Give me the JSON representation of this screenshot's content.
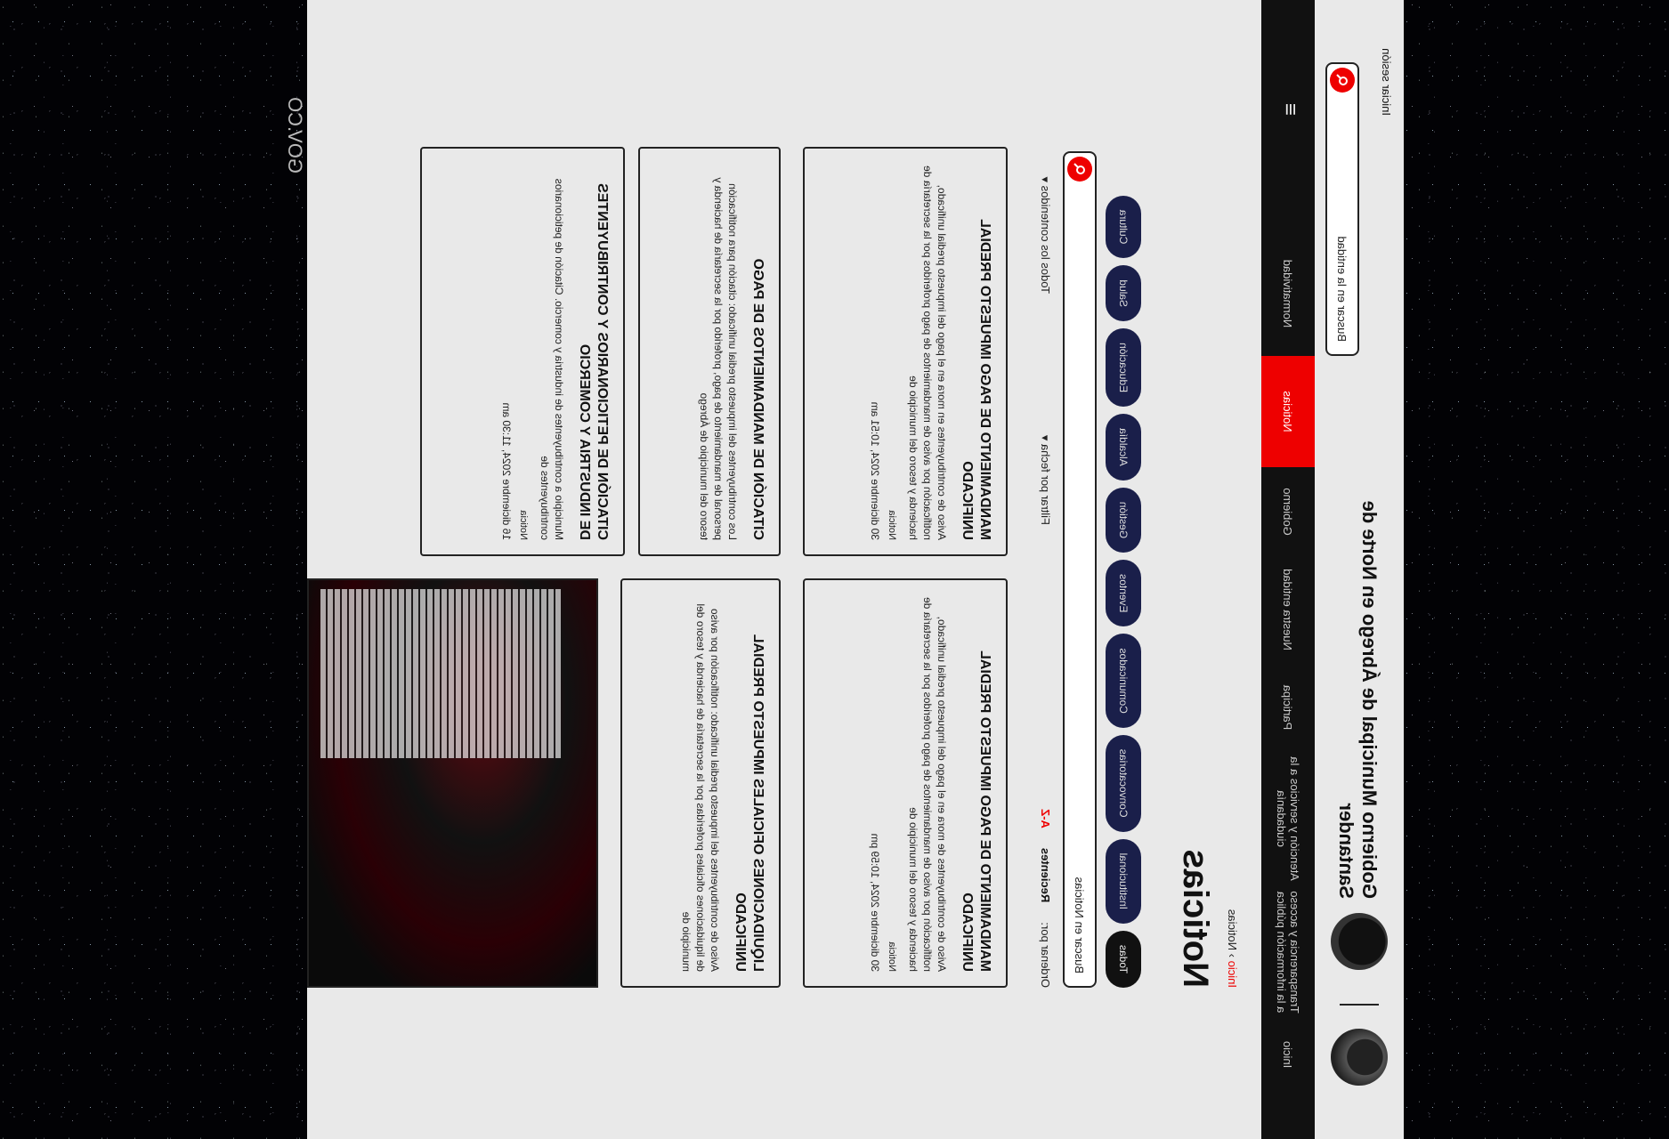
{
  "gov": {
    "logo": "GOV.CO"
  },
  "header": {
    "entity": "Gobierno Municipal de Ábrego en Norte de Santander",
    "search_placeholder": "Buscar en la entidad",
    "login": "Iniciar sesión"
  },
  "nav": {
    "items": [
      "Inicio",
      "Transparencia y acceso a la información pública",
      "Atención y servicios a la ciudadanía",
      "Participa",
      "Nuestra entidad",
      "Gobierno",
      "Noticias",
      "Normatividad"
    ],
    "active": "Noticias"
  },
  "breadcrumb": {
    "home": "Inicio",
    "current": "Noticias"
  },
  "page": {
    "title": "Noticias"
  },
  "filters": {
    "chips": [
      "Todas",
      "Institucional",
      "Convocatorias",
      "Comunicados",
      "Eventos",
      "Gestión",
      "Alcaldía",
      "Educación",
      "Salud",
      "Cultura"
    ],
    "selected": "Todas"
  },
  "news_search": {
    "placeholder": "Buscar en Noticias"
  },
  "sort": {
    "label": "Ordenar por:",
    "active": "Recientes",
    "alt": "A-Z"
  },
  "date_filter": "Filtrar por fecha",
  "contents_filter": "Todos los contenidos",
  "cards": [
    {
      "title": "Liquidaciones oficiales impuesto predial unificado",
      "desc": "Aviso de contribuyentes del impuesto predial unificado: notificación por aviso de liquidaciones oficiales proferidas por la secretaría de hacienda y tesoro del municipio de",
      "tag": "",
      "date": ""
    },
    {
      "title": "Mandamiento de pago impuesto predial unificado",
      "desc": "Aviso de contribuyentes de mora en el pago del impuesto predial unificado, notificación por aviso de mandamientos de pago proferidos por la secretaría de hacienda y tesoro del municipio de",
      "tag": "Noticia",
      "date": "30 diciembre 2024, 10:59 pm"
    },
    {
      "title": "Citación de peticionarios y contribuyentes de industria y comercio",
      "desc": "Municipio a contribuyentes de industria y comercio. Citación de peticionarios contribuyentes de",
      "tag": "Noticia",
      "date": "16 diciembre 2024, 11:30 am"
    },
    {
      "title": "Citación de mandamientos de pago",
      "desc": "Los contribuyentes del impuesto predial unificado: citación para notificación personal de mandamiento de pago, proferido por la secretaría de hacienda y tesoro del municipio de Ábrego",
      "tag": "",
      "date": ""
    },
    {
      "title": "Mandamiento de pago impuesto predial unificado",
      "desc": "Aviso de contribuyentes en mora en el pago del impuesto predial unificado, notificación por aviso de mandamientos de pago proferidos por la secretaría de hacienda y tesoro del municipio de",
      "tag": "Noticia",
      "date": "30 diciembre 2024, 10:51 am"
    }
  ],
  "colors": {
    "accent": "#e00000",
    "nav_bg": "#111111",
    "chip_bg": "#1a1f4a"
  }
}
